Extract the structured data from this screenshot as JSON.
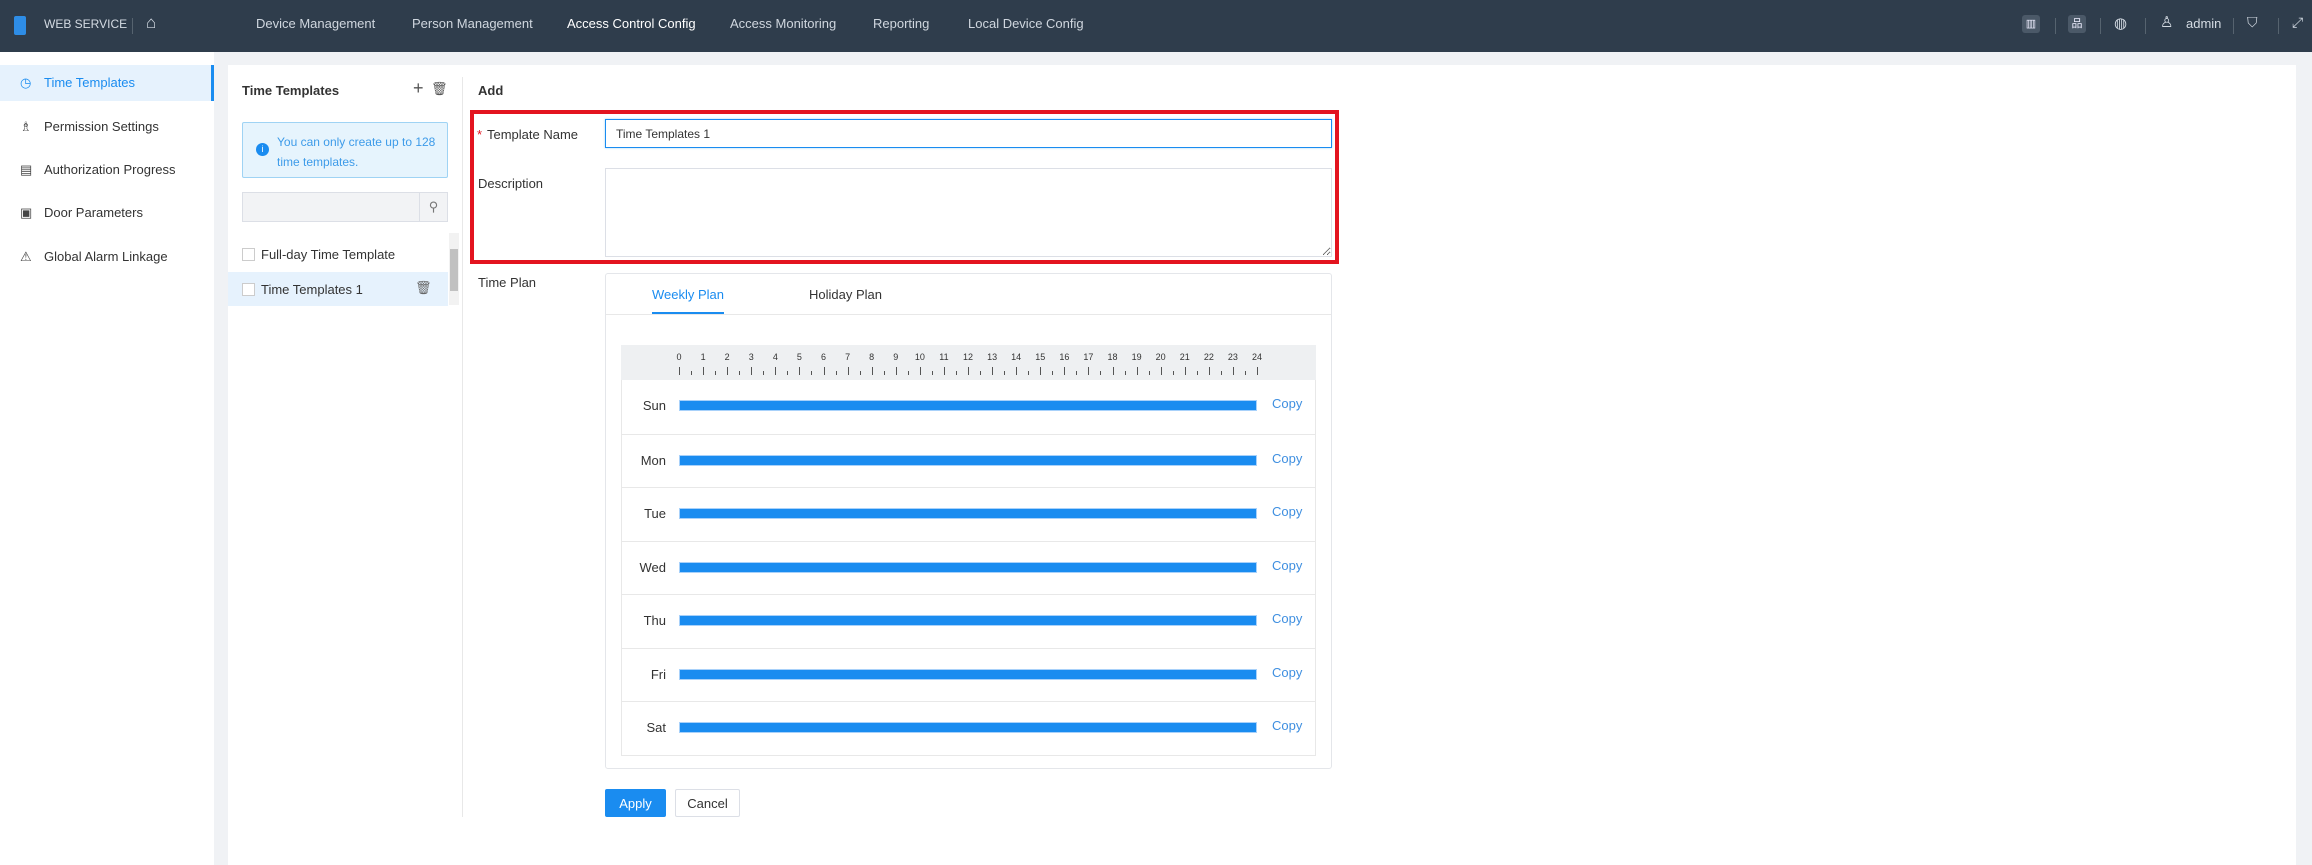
{
  "header": {
    "brand": "WEB SERVICE",
    "nav": [
      "Device Management",
      "Person Management",
      "Access Control Config",
      "Access Monitoring",
      "Reporting",
      "Local Device Config"
    ],
    "active_nav": "Access Control Config",
    "user": "admin"
  },
  "sidebar": {
    "items": [
      "Time Templates",
      "Permission Settings",
      "Authorization Progress",
      "Door Parameters",
      "Global Alarm Linkage"
    ]
  },
  "list": {
    "title": "Time Templates",
    "info": "You can only create up to 128 time templates.",
    "search_placeholder": "",
    "items": [
      "Full-day Time Template",
      "Time Templates 1"
    ]
  },
  "form": {
    "title": "Add",
    "name_label": "Template Name",
    "name_value": "Time Templates 1",
    "desc_label": "Description",
    "desc_value": "",
    "plan_label": "Time Plan",
    "tabs": [
      "Weekly Plan",
      "Holiday Plan"
    ],
    "hours": [
      "0",
      "1",
      "2",
      "3",
      "4",
      "5",
      "6",
      "7",
      "8",
      "9",
      "10",
      "11",
      "12",
      "13",
      "14",
      "15",
      "16",
      "17",
      "18",
      "19",
      "20",
      "21",
      "22",
      "23",
      "24"
    ],
    "days": [
      {
        "day": "Sun",
        "start": 0,
        "end": 24
      },
      {
        "day": "Mon",
        "start": 0,
        "end": 24
      },
      {
        "day": "Tue",
        "start": 0,
        "end": 24
      },
      {
        "day": "Wed",
        "start": 0,
        "end": 24
      },
      {
        "day": "Thu",
        "start": 0,
        "end": 24
      },
      {
        "day": "Fri",
        "start": 0,
        "end": 24
      },
      {
        "day": "Sat",
        "start": 0,
        "end": 24
      }
    ],
    "copy_label": "Copy",
    "apply": "Apply",
    "cancel": "Cancel"
  },
  "colors": {
    "accent": "#1a8cf0",
    "highlight": "#e3141f",
    "topbar": "#2f3d4c"
  }
}
